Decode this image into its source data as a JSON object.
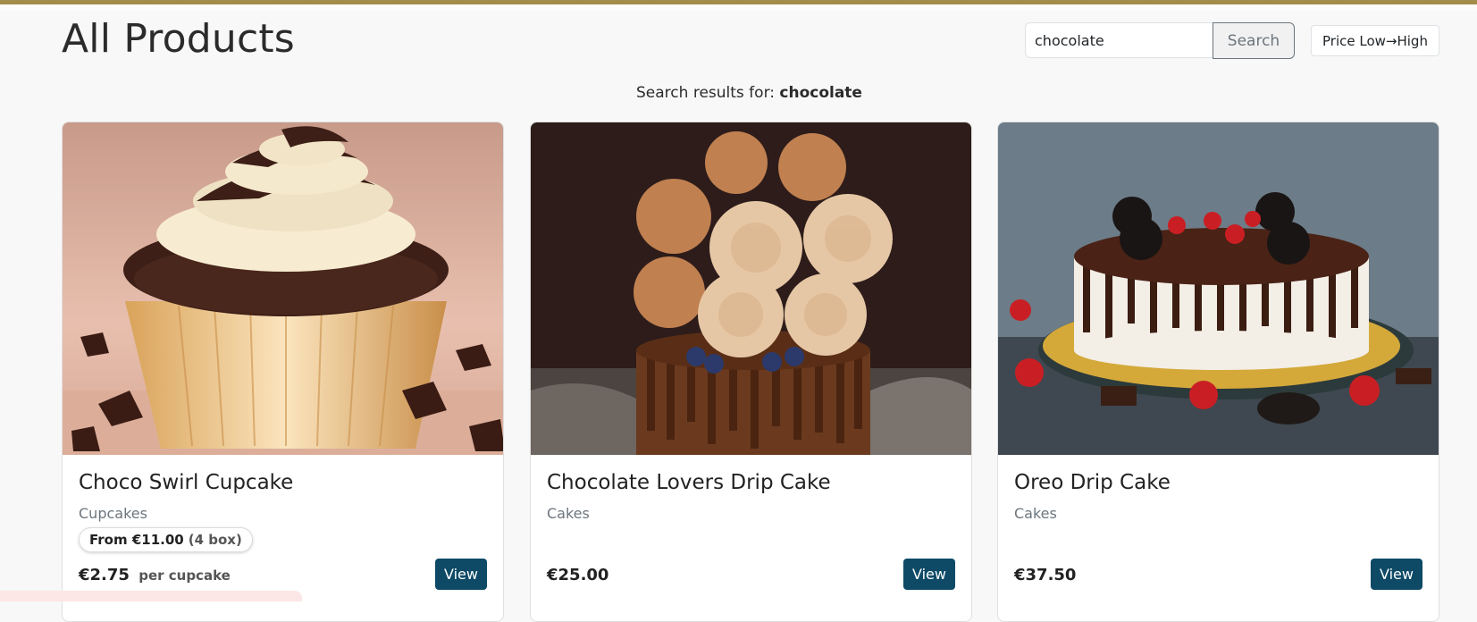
{
  "page": {
    "title": "All Products"
  },
  "search": {
    "value": "chocolate",
    "button_label": "Search"
  },
  "sort": {
    "selected": "Price Low→High"
  },
  "results": {
    "prefix": "Search results for:",
    "query": "chocolate"
  },
  "products": [
    {
      "name": "Choco Swirl Cupcake",
      "category": "Cupcakes",
      "bundle_from": "From €11.00",
      "bundle_box": "(4 box)",
      "price": "€2.75",
      "price_unit": "per cupcake",
      "view_label": "View"
    },
    {
      "name": "Chocolate Lovers Drip Cake",
      "category": "Cakes",
      "price": "€25.00",
      "view_label": "View"
    },
    {
      "name": "Oreo Drip Cake",
      "category": "Cakes",
      "price": "€37.50",
      "view_label": "View"
    }
  ],
  "colors": {
    "accent_bar": "#a48d4b",
    "view_button": "#0e4a66"
  }
}
